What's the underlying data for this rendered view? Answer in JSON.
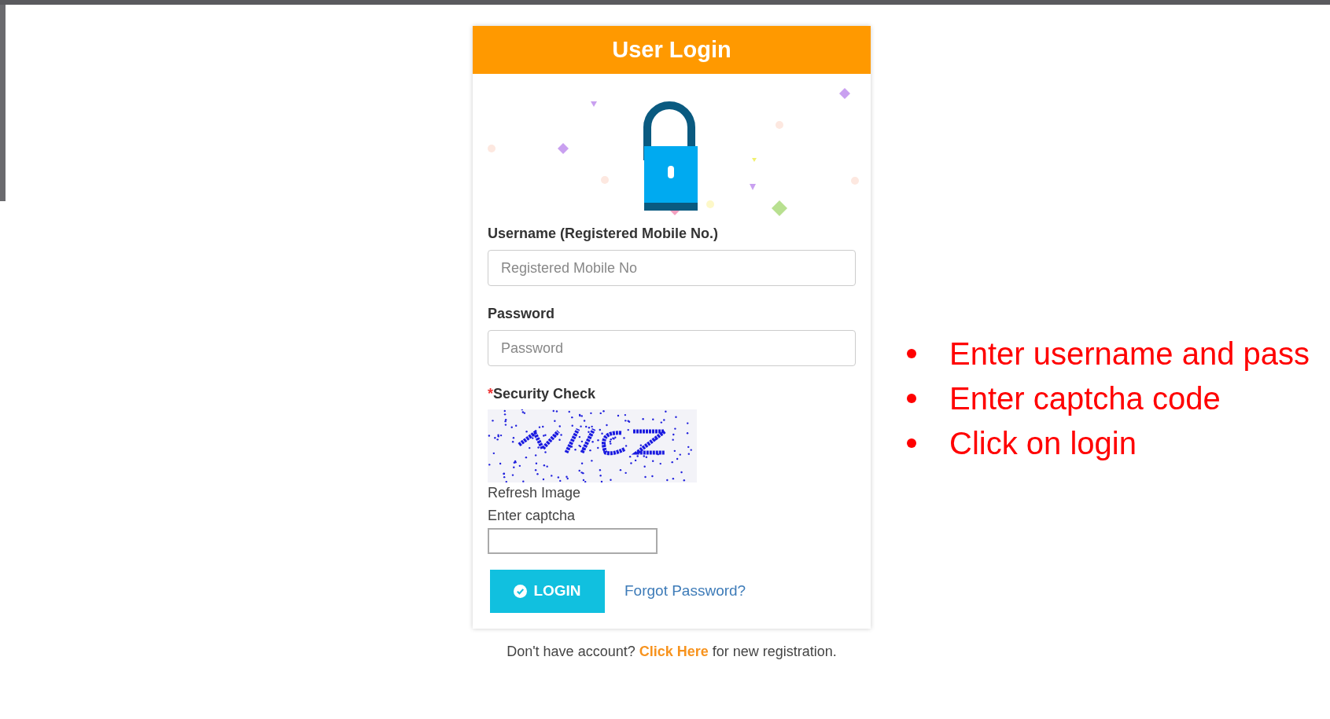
{
  "login_card": {
    "title": "User Login",
    "username": {
      "label": "Username (Registered Mobile No.)",
      "placeholder": "Registered Mobile No"
    },
    "password": {
      "label": "Password",
      "placeholder": "Password"
    },
    "security_check": {
      "required_mark": "*",
      "label": "Security Check",
      "refresh_link": "Refresh Image",
      "captcha_label": "Enter captcha"
    },
    "login_button": "LOGIN",
    "forgot_link": "Forgot Password?"
  },
  "registration": {
    "before": "Don't have account?",
    "link": "Click Here",
    "after": "for new registration."
  },
  "instructions": [
    "Enter username and pass",
    "Enter captcha code",
    "Click on login"
  ]
}
